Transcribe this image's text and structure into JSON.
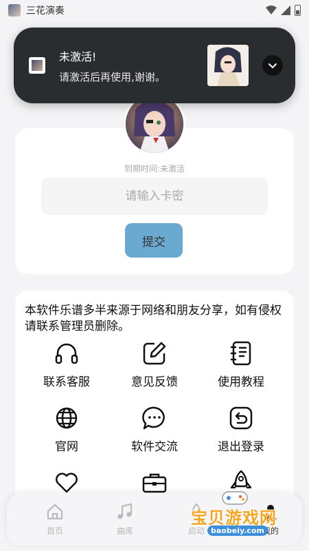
{
  "status_bar": {
    "app_name": "三花演奏"
  },
  "notification": {
    "title": "未激活!",
    "message": "请激活后再使用,谢谢。"
  },
  "activation": {
    "expiry_text": "到期时间:未激活",
    "key_placeholder": "请输入卡密",
    "submit_label": "提交"
  },
  "notice": {
    "text": "本软件乐谱多半来源于网络和朋友分享，如有侵权请联系管理员删除。"
  },
  "menu": {
    "items": [
      {
        "label": "联系客服",
        "icon": "headphones-icon"
      },
      {
        "label": "意见反馈",
        "icon": "edit-icon"
      },
      {
        "label": "使用教程",
        "icon": "notebook-icon"
      },
      {
        "label": "官网",
        "icon": "globe-icon"
      },
      {
        "label": "软件交流",
        "icon": "chat-icon"
      },
      {
        "label": "退出登录",
        "icon": "logout-icon"
      },
      {
        "label": "",
        "icon": "heart-icon"
      },
      {
        "label": "",
        "icon": "briefcase-icon"
      },
      {
        "label": "",
        "icon": "rocket-icon"
      }
    ]
  },
  "bottom_nav": {
    "items": [
      {
        "label": "首页",
        "icon": "home-icon"
      },
      {
        "label": "曲库",
        "icon": "music-icon"
      },
      {
        "label": "启动",
        "icon": "rocket-icon"
      },
      {
        "label": "我的",
        "icon": "user-icon"
      }
    ]
  },
  "watermark": {
    "text": "宝贝游戏网",
    "url": "baobeiy.com"
  },
  "colors": {
    "accent": "#6aaad0",
    "notification_bg": "#2a2d30",
    "page_bg": "#f4f4f6"
  }
}
